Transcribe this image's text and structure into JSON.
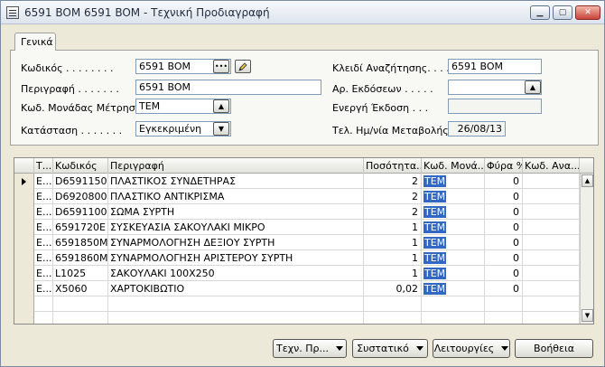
{
  "window": {
    "title": "6591 BOM 6591 BOM - Τεχνική Προδιαγραφή"
  },
  "tabs": [
    {
      "label": "Γενικά"
    }
  ],
  "form": {
    "code_label": "Κωδικός  .  .  .  .  .  .  .  .",
    "code_value": "6591 BOM",
    "description_label": "Περιγραφή  .  .  .  .  .  .  .",
    "description_value": "6591 BOM",
    "unit_label": "Κωδ. Μονάδας Μέτρησης",
    "unit_value": "TEM",
    "status_label": "Κατάσταση  .  .  .  .  .  .  .",
    "status_value": "Εγκεκριμένη",
    "search_key_label": "Κλειδί Αναζήτησης.  .  .  .",
    "search_key_value": "6591 BOM",
    "version_label": "Αρ. Εκδόσεων  .  .  .  .  .",
    "version_value": "",
    "active_version_label": "Ενεργή Έκδοση  .  .  .",
    "active_version_value": "",
    "last_modified_label": "Τελ. Ημ/νία Μεταβολής  .  .",
    "last_modified_value": "26/08/13"
  },
  "grid": {
    "headers": {
      "type": "Τ...",
      "code": "Κωδικός",
      "description": "Περιγραφή",
      "quantity": "Ποσότητα...",
      "unit": "Κωδ. Μονά...",
      "scrap": "Φύρα %",
      "alt": "Κωδ. Ανα..."
    },
    "rows": [
      {
        "type": "E...",
        "code": "D6591150",
        "description": "ΠΛΑΣΤΙΚΟΣ ΣΥΝΔΕΤΗΡΑΣ",
        "quantity": "2",
        "unit": "TEM",
        "scrap": "0"
      },
      {
        "type": "E...",
        "code": "D6920800",
        "description": "ΠΛΑΣΤΙΚΟ ΑΝΤΙΚΡΙΣΜΑ",
        "quantity": "2",
        "unit": "TEM",
        "scrap": "0"
      },
      {
        "type": "E...",
        "code": "D6591100",
        "description": "ΣΩΜΑ ΣΥΡΤΗ",
        "quantity": "2",
        "unit": "TEM",
        "scrap": "0"
      },
      {
        "type": "E...",
        "code": "6591720E",
        "description": "ΣΥΣΚΕΥΑΣΙΑ ΣΑΚΟΥΛΑΚΙ ΜΙΚΡΟ",
        "quantity": "1",
        "unit": "TEM",
        "scrap": "0"
      },
      {
        "type": "E...",
        "code": "6591850M",
        "description": "ΣΥΝΑΡΜΟΛΟΓΗΣΗ ΔΕΞΙΟΥ ΣΥΡΤΗ",
        "quantity": "1",
        "unit": "TEM",
        "scrap": "0"
      },
      {
        "type": "E...",
        "code": "6591860M",
        "description": "ΣΥΝΑΡΜΟΛΟΓΗΣΗ ΑΡΙΣΤΕΡΟΥ ΣΥΡΤΗ",
        "quantity": "1",
        "unit": "TEM",
        "scrap": "0"
      },
      {
        "type": "E...",
        "code": "L1025",
        "description": "ΣΑΚΟΥΛΑΚΙ 100X250",
        "quantity": "1",
        "unit": "TEM",
        "scrap": "0"
      },
      {
        "type": "E...",
        "code": "X5060",
        "description": "ΧΑΡΤΟΚΙΒΩΤΙΟ",
        "quantity": "0,02",
        "unit": "TEM",
        "scrap": "0"
      }
    ]
  },
  "buttons": {
    "tech_spec": "Τεχν. Πρ...",
    "components": "Συστατικό",
    "functions": "Λειτουργίες",
    "help": "Βοήθεια"
  },
  "colors": {
    "selection": "#3168c5",
    "window_bg": "#ece9d8"
  }
}
